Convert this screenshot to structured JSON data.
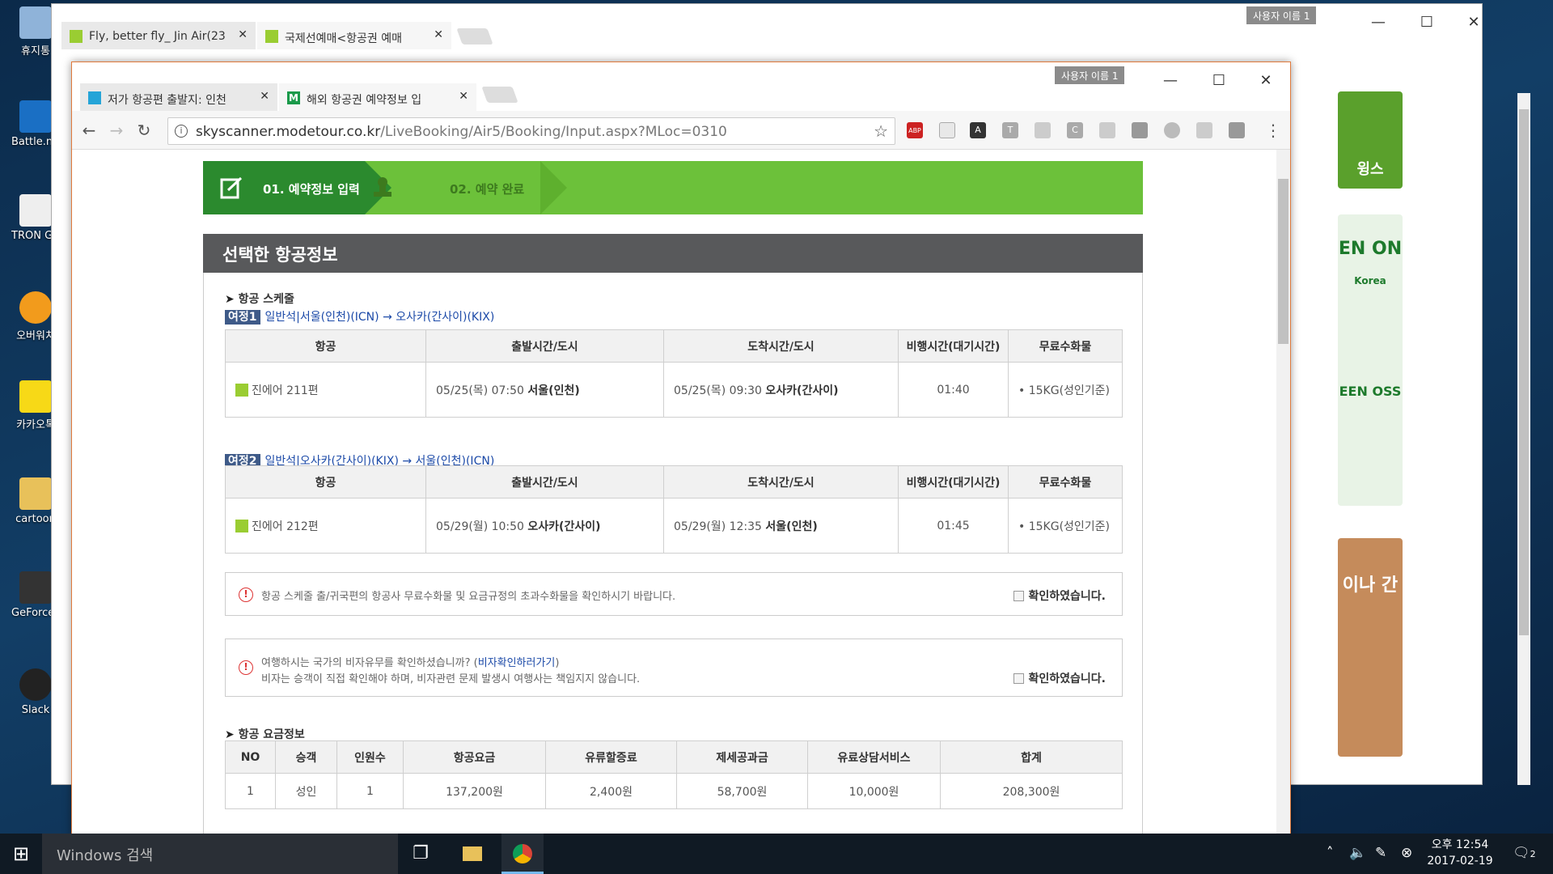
{
  "desktop": {
    "icons": [
      {
        "label": "휴지통"
      },
      {
        "label": "Battle.net"
      },
      {
        "label": "TRON Gaming"
      },
      {
        "label": "오버워치"
      },
      {
        "label": "카카오톡"
      },
      {
        "label": "cartoon"
      },
      {
        "label": "GeForce Experience"
      },
      {
        "label": "Slack"
      }
    ]
  },
  "back_window": {
    "tabs": [
      {
        "title": "Fly, better fly_ Jin Air(23"
      },
      {
        "title": "국제선예매<항공권 예매"
      }
    ],
    "profile": "사용자 이름 1",
    "ads": [
      {
        "text": "윙스"
      },
      {
        "text": "EN ON"
      },
      {
        "text": "Korea"
      },
      {
        "text": "EEN OSS"
      },
      {
        "text": "이나 간"
      }
    ]
  },
  "front_window": {
    "tabs": [
      {
        "title": "저가 항공편 출발지: 인천"
      },
      {
        "title": "해외 항공권 예약정보 입"
      }
    ],
    "profile": "사용자 이름 1",
    "url": {
      "host": "skyscanner.modetour.co.kr",
      "path": "/LiveBooking/Air5/Booking/Input.aspx?MLoc=0310"
    },
    "extensions": [
      "ABP",
      "2",
      "A",
      "T",
      "C"
    ]
  },
  "page": {
    "steps": {
      "step1": "01. 예약정보 입력",
      "step2": "02. 예약 완료"
    },
    "section_title": "선택한 항공정보",
    "schedule_label": "항공 스케줄",
    "table_headers": [
      "항공",
      "출발시간/도시",
      "도착시간/도시",
      "비행시간(대기시간)",
      "무료수화물"
    ],
    "legs": [
      {
        "badge": "여정1",
        "route": "일반석|서울(인천)(ICN) → 오사카(간사이)(KIX)",
        "airline": "진에어 211편",
        "dep_time": "05/25(목) 07:50",
        "dep_city": "서울(인천)",
        "arr_time": "05/25(목) 09:30",
        "arr_city": "오사카(간사이)",
        "duration": "01:40",
        "baggage": "15KG(성인기준)"
      },
      {
        "badge": "여정2",
        "route": "일반석|오사카(간사이)(KIX) → 서울(인천)(ICN)",
        "airline": "진에어 212편",
        "dep_time": "05/29(월) 10:50",
        "dep_city": "오사카(간사이)",
        "arr_time": "05/29(월) 12:35",
        "arr_city": "서울(인천)",
        "duration": "01:45",
        "baggage": "15KG(성인기준)"
      }
    ],
    "notice1": {
      "text": "항공 스케줄 출/귀국편의 항공사 무료수화물 및 요금규정의 초과수화물을 확인하시기 바랍니다.",
      "check": "확인하였습니다."
    },
    "notice2": {
      "line1_prefix": "여행하시는 국가의 비자유무를 확인하셨습니까? (",
      "link": "비자확인하러가기",
      "line1_suffix": ")",
      "line2": "비자는 승객이 직접 확인해야 하며, 비자관련 문제 발생시 여행사는 책임지지 않습니다.",
      "check": "확인하였습니다."
    },
    "fare_label": "항공 요금정보",
    "fare_headers": [
      "NO",
      "승객",
      "인원수",
      "항공요금",
      "유류할증료",
      "제세공과금",
      "유료상담서비스",
      "합계"
    ],
    "fare_rows": [
      [
        "1",
        "성인",
        "1",
        "137,200원",
        "2,400원",
        "58,700원",
        "10,000원",
        "208,300원"
      ]
    ]
  },
  "taskbar": {
    "search": "Windows 검색",
    "clock_time": "오후 12:54",
    "clock_date": "2017-02-19",
    "notif_count": "2"
  }
}
